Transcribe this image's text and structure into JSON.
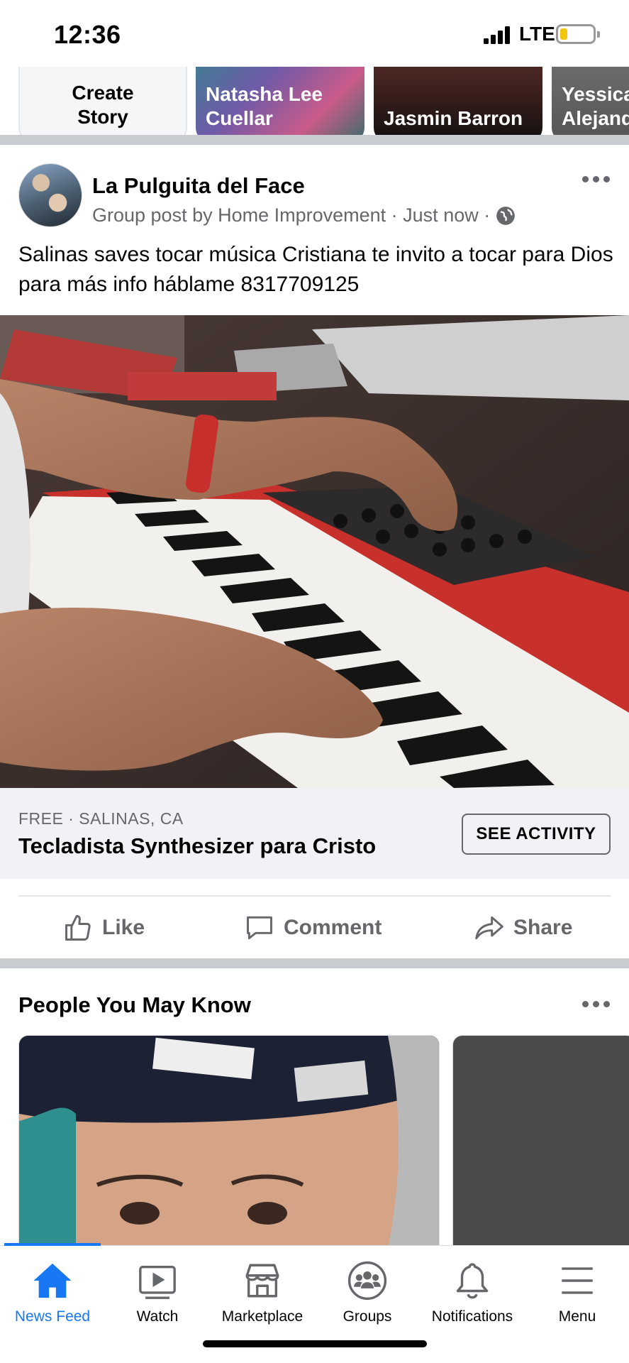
{
  "status_bar": {
    "time": "12:36",
    "network": "LTE"
  },
  "stories": [
    {
      "label": "Create Story",
      "kind": "create"
    },
    {
      "label": "Natasha Lee Cuellar",
      "kind": "person"
    },
    {
      "label": "Jasmin Barron",
      "kind": "person"
    },
    {
      "label": "Yessica Alejandra",
      "kind": "person"
    }
  ],
  "post": {
    "author": "La Pulguita del Face",
    "meta": "Group post by Home Improvement · Just now ·",
    "text": "Salinas  saves tocar música Cristiana te invito a tocar para Dios para más info háblame 8317709125",
    "listing": {
      "meta": "FREE · SALINAS, CA",
      "title": "Tecladista Synthesizer para Cristo",
      "button": "SEE ACTIVITY"
    },
    "actions": {
      "like": "Like",
      "comment": "Comment",
      "share": "Share"
    }
  },
  "pymk": {
    "title": "People You May Know"
  },
  "tabs": [
    {
      "label": "News Feed",
      "icon": "home-icon",
      "active": true
    },
    {
      "label": "Watch",
      "icon": "watch-icon",
      "active": false
    },
    {
      "label": "Marketplace",
      "icon": "marketplace-icon",
      "active": false
    },
    {
      "label": "Groups",
      "icon": "groups-icon",
      "active": false
    },
    {
      "label": "Notifications",
      "icon": "bell-icon",
      "active": false
    },
    {
      "label": "Menu",
      "icon": "menu-icon",
      "active": false
    }
  ],
  "colors": {
    "accent": "#1877f2",
    "secondary_text": "#65676b",
    "divider": "#c9ccd1",
    "listing_bg": "#f0f2f5"
  }
}
